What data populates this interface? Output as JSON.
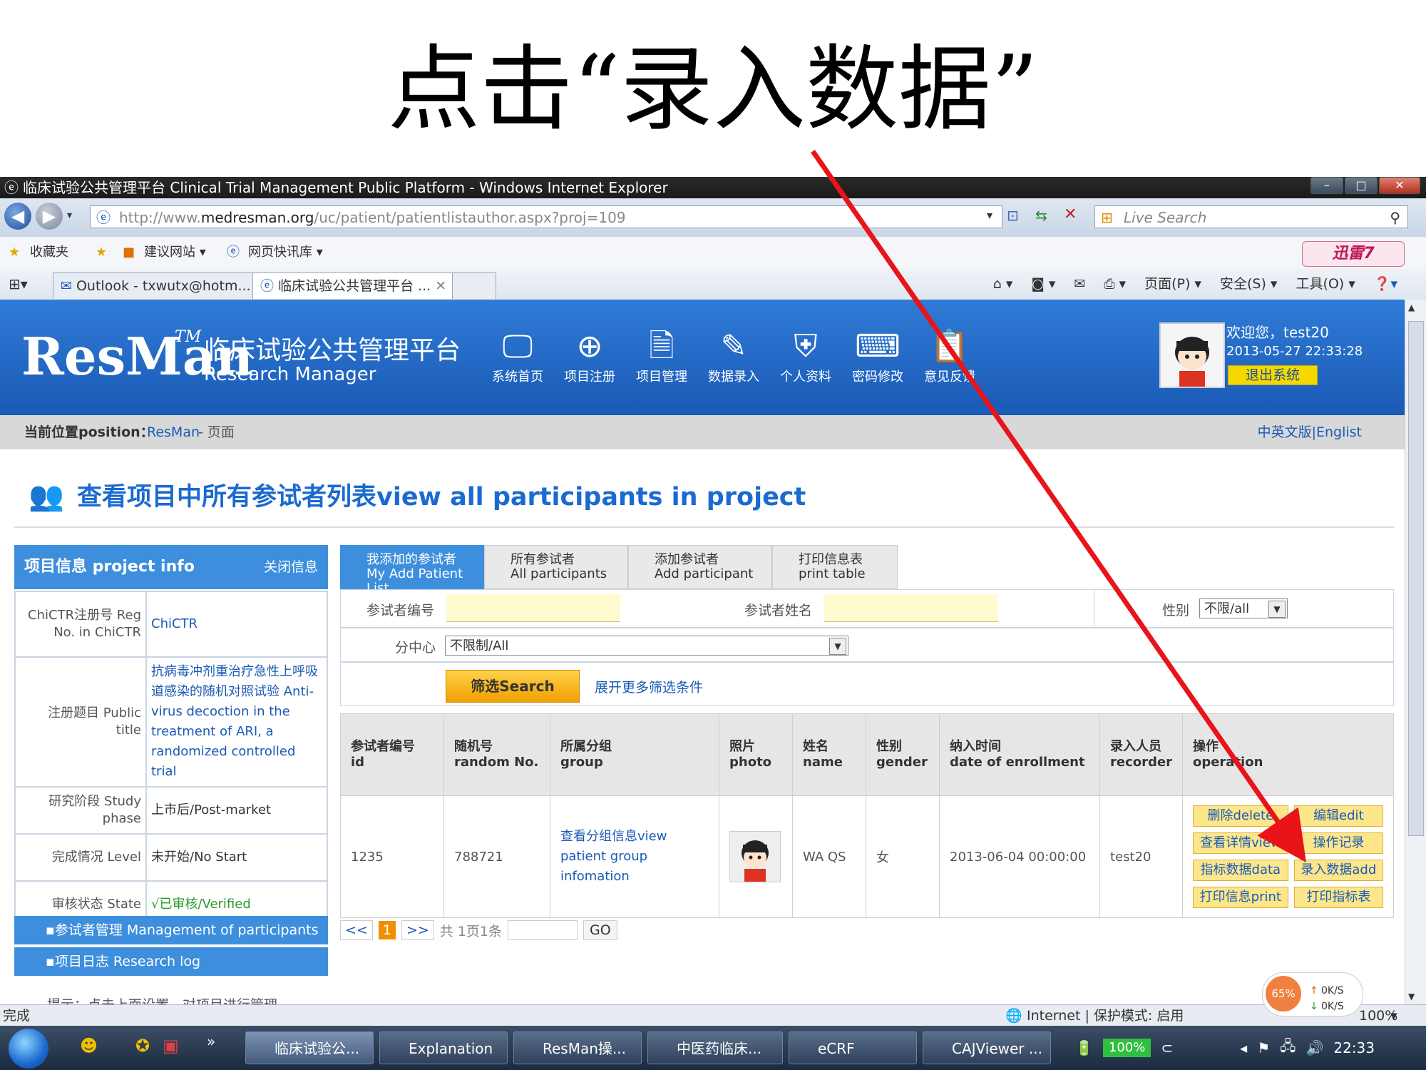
{
  "slide": {
    "title": "点击“录入数据”"
  },
  "window": {
    "title": "临床试验公共管理平台 Clinical Trial Management Public Platform - Windows Internet Explorer",
    "url_prefix": "http://www.",
    "url_domain": "medresman.org",
    "url_path": "/uc/patient/patientlistauthor.aspx?proj=109",
    "search_placeholder": "Live Search",
    "favorites": [
      "收藏夹",
      "建议网站 ▾",
      "网页快讯库 ▾"
    ],
    "xunlei": "迅雷7",
    "tabs": [
      "Outlook - txwutx@hotm...",
      "临床试验公共管理平台 ..."
    ],
    "commands": [
      "页面(P) ▾",
      "安全(S) ▾",
      "工具(O) ▾"
    ]
  },
  "site": {
    "logo": "ResMan",
    "tm": "TM",
    "name_cn": "临床试验公共管理平台",
    "name_en": "Research Manager",
    "nav": [
      "系统首页",
      "项目注册",
      "项目管理",
      "数据录入",
      "个人资料",
      "密码修改",
      "意见反馈"
    ],
    "welcome": "欢迎您，test20",
    "datetime": "2013-05-27 22:33:28",
    "logout": "退出系统",
    "crumb_label": "当前位置position：",
    "crumb_link": "ResMan",
    "crumb_page": " - 页面",
    "lang": "中英文版|Englist"
  },
  "page_heading": "查看项目中所有参试者列表view all participants in project",
  "project_info": {
    "title": "项目信息 project info",
    "close": "关闭信息",
    "rows": [
      {
        "k": "ChiCTR注册号 Reg No. in ChiCTR",
        "v": "ChiCTR"
      },
      {
        "k": "注册题目 Public title",
        "v": "抗病毒冲剂重治疗急性上呼吸道感染的随机对照试验 Anti-virus decoction in the treatment of ARI, a randomized controlled trial"
      },
      {
        "k": "研究阶段 Study phase",
        "v": "上市后/Post-market"
      },
      {
        "k": "完成情况 Level",
        "v": "未开始/No Start"
      },
      {
        "k": "审核状态 State",
        "v": "√已审核/Verified"
      }
    ],
    "menu": [
      "▪参试者管理 Management of participants",
      "▪项目日志 Research log"
    ],
    "hint": "提示：点击上面设置，对项目进行管理。"
  },
  "list_tabs": [
    {
      "cn": "我添加的参试者",
      "en": "My Add Patient List"
    },
    {
      "cn": "所有参试者",
      "en": "All participants"
    },
    {
      "cn": "添加参试者",
      "en": "Add participant"
    },
    {
      "cn": "打印信息表",
      "en": "print table"
    }
  ],
  "filter": {
    "id_label": "参试者编号",
    "name_label": "参试者姓名",
    "gender_label": "性别",
    "gender_value": "不限/all",
    "center_label": "分中心",
    "center_value": "不限制/All",
    "search_btn": "筛选Search",
    "more": "展开更多筛选条件"
  },
  "table": {
    "headers": [
      {
        "cn": "参试者编号",
        "en": "id"
      },
      {
        "cn": "随机号",
        "en": "random No."
      },
      {
        "cn": "所属分组",
        "en": "group"
      },
      {
        "cn": "照片",
        "en": "photo"
      },
      {
        "cn": "姓名",
        "en": "name"
      },
      {
        "cn": "性别",
        "en": "gender"
      },
      {
        "cn": "纳入时间",
        "en": "date of enrollment"
      },
      {
        "cn": "录入人员",
        "en": "recorder"
      },
      {
        "cn": "操作",
        "en": "operation"
      }
    ],
    "row": {
      "id": "1235",
      "random": "788721",
      "group": "查看分组信息view patient group infomation",
      "name": "WA QS",
      "gender": "女",
      "date": "2013-06-04 00:00:00",
      "recorder": "test20",
      "ops": [
        "删除delete",
        "编辑edit",
        "查看详情view",
        "操作记录",
        "指标数据data",
        "录入数据add",
        "打印信息print",
        "打印指标表"
      ]
    }
  },
  "pager": {
    "prev": "<<",
    "current": "1",
    "next": ">>",
    "summary": "共 1页1条",
    "go": "GO"
  },
  "status": {
    "left": "完成",
    "zone": "Internet | 保护模式: 启用",
    "zoom": "100%"
  },
  "taskbar": {
    "items": [
      "临床试验公...",
      "Explanation",
      "ResMan操...",
      "中医药临床...",
      "eCRF",
      "CAJViewer ..."
    ],
    "battery": "100%",
    "clock": "22:33",
    "cpu": "65%",
    "up": "0K/S",
    "down": "0K/S"
  },
  "colors": {
    "brand": "#1a5ab6",
    "accent": "#3d8fdd",
    "arrow": "#e8141a"
  }
}
